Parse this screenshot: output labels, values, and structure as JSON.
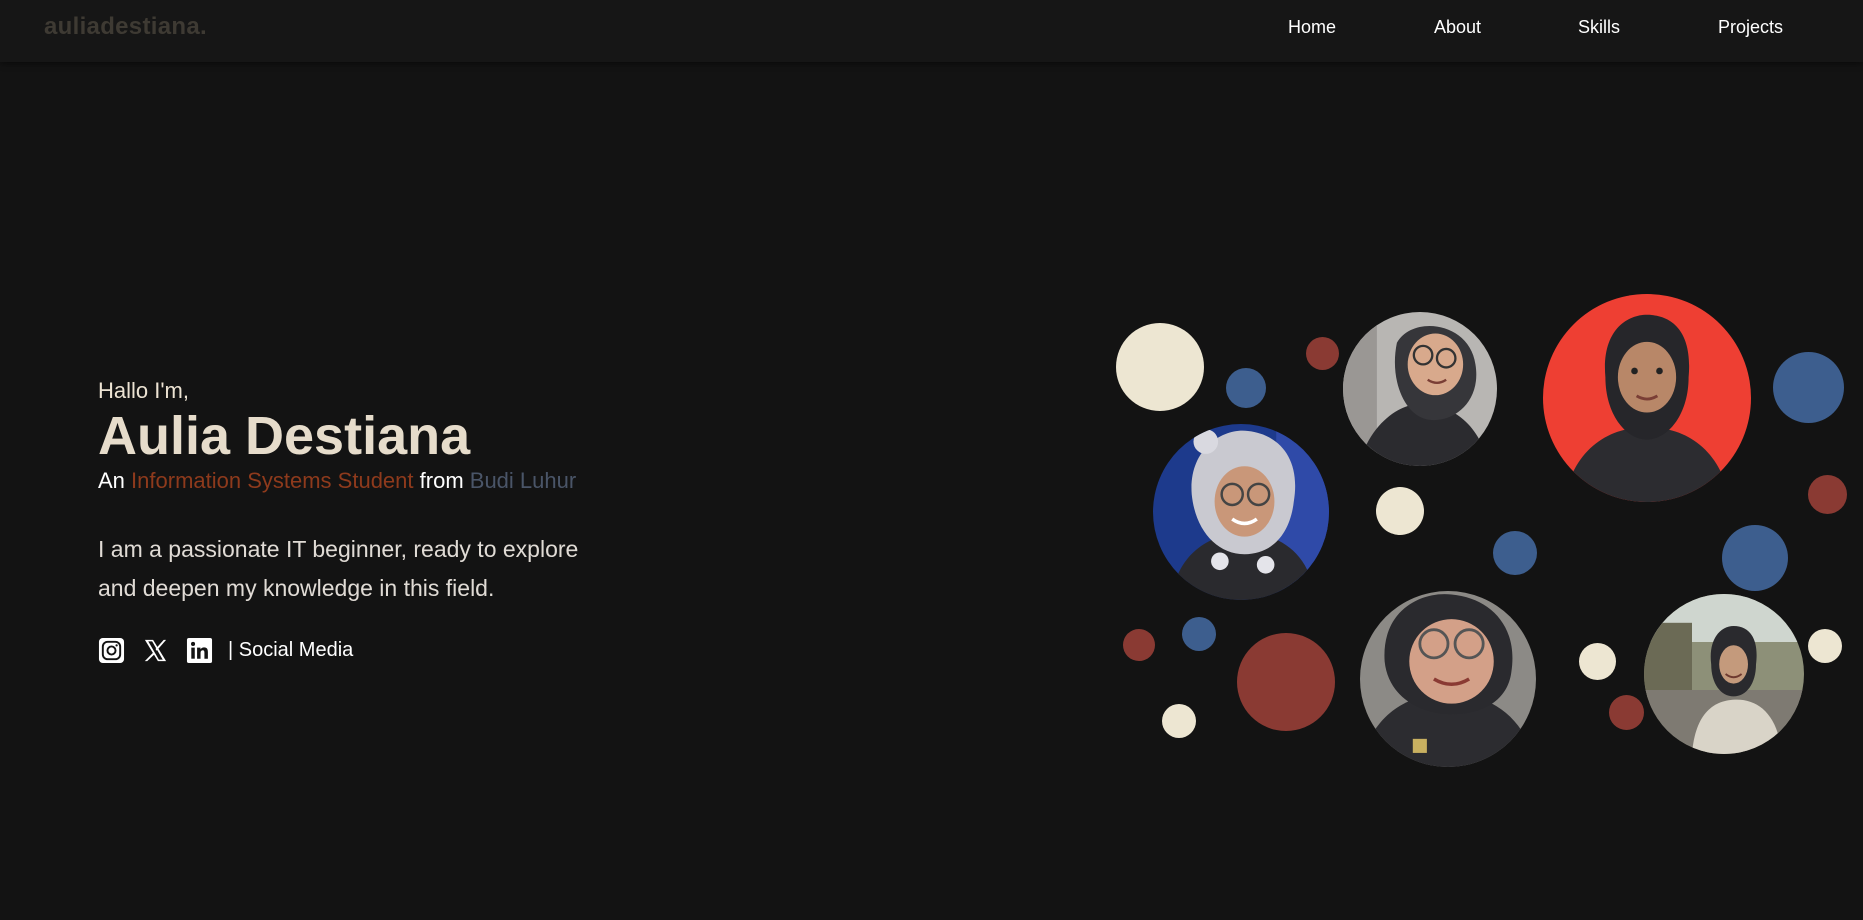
{
  "header": {
    "brand": "auliadestiana.",
    "nav": [
      {
        "label": "Home"
      },
      {
        "label": "About"
      },
      {
        "label": "Skills"
      },
      {
        "label": "Projects"
      }
    ]
  },
  "hero": {
    "greeting": "Hallo I'm,",
    "name": "Aulia Destiana",
    "tagline": {
      "prefix": "An",
      "role": "Information Systems Student",
      "middle": "from",
      "school": "Budi Luhur"
    },
    "bio_line1": "I am a passionate IT beginner, ready to explore",
    "bio_line2": "and deepen my knowledge in this field.",
    "social": {
      "icons": [
        "instagram-icon",
        "x-icon",
        "linkedin-icon"
      ],
      "label": "| Social Media"
    }
  },
  "colors": {
    "background": "#131313",
    "cream": "#ede6d2",
    "blue": "#3d5e8e",
    "red": "#8a3a33",
    "photo_red": "#ee3f33",
    "accent_orange": "#8e3a1c",
    "accent_gray": "#4a5568"
  }
}
